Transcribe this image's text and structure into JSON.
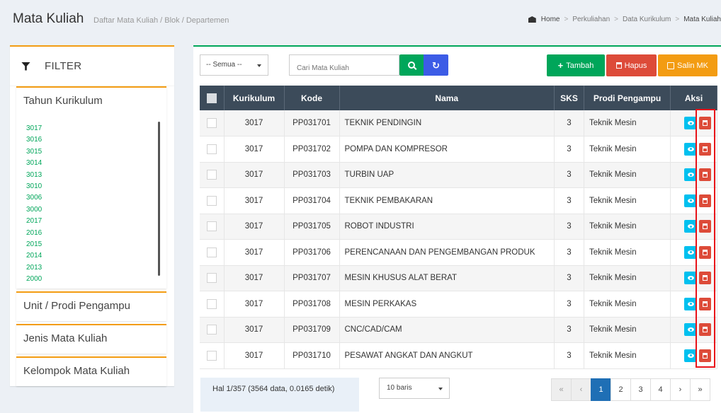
{
  "header": {
    "title": "Mata Kuliah",
    "subtitle": "Daftar Mata Kuliah / Blok / Departemen",
    "breadcrumb": [
      "Home",
      "Perkuliahan",
      "Data Kurikulum",
      "Mata Kuliah"
    ]
  },
  "filter": {
    "title": "FILTER",
    "tahun_label": "Tahun Kurikulum",
    "years": [
      "3017",
      "3016",
      "3015",
      "3014",
      "3013",
      "3010",
      "3006",
      "3000",
      "2017",
      "2016",
      "2015",
      "2014",
      "2013",
      "2000"
    ],
    "unit_label": "Unit / Prodi Pengampu",
    "jenis_label": "Jenis Mata Kuliah",
    "kelompok_label": "Kelompok Mata Kuliah"
  },
  "toolbar": {
    "select_value": "-- Semua --",
    "search_placeholder": "Cari Mata Kuliah",
    "tambah_label": "Tambah",
    "hapus_label": "Hapus",
    "salin_label": "Salin MK"
  },
  "table": {
    "columns": [
      "Kurikulum",
      "Kode",
      "Nama",
      "SKS",
      "Prodi Pengampu",
      "Aksi"
    ],
    "rows": [
      {
        "kurikulum": "3017",
        "kode": "PP031701",
        "nama": "TEKNIK PENDINGIN",
        "sks": "3",
        "prodi": "Teknik Mesin"
      },
      {
        "kurikulum": "3017",
        "kode": "PP031702",
        "nama": "POMPA DAN KOMPRESOR",
        "sks": "3",
        "prodi": "Teknik Mesin"
      },
      {
        "kurikulum": "3017",
        "kode": "PP031703",
        "nama": "TURBIN UAP",
        "sks": "3",
        "prodi": "Teknik Mesin"
      },
      {
        "kurikulum": "3017",
        "kode": "PP031704",
        "nama": "TEKNIK PEMBAKARAN",
        "sks": "3",
        "prodi": "Teknik Mesin"
      },
      {
        "kurikulum": "3017",
        "kode": "PP031705",
        "nama": "ROBOT INDUSTRI",
        "sks": "3",
        "prodi": "Teknik Mesin"
      },
      {
        "kurikulum": "3017",
        "kode": "PP031706",
        "nama": "PERENCANAAN DAN PENGEMBANGAN PRODUK",
        "sks": "3",
        "prodi": "Teknik Mesin"
      },
      {
        "kurikulum": "3017",
        "kode": "PP031707",
        "nama": "MESIN KHUSUS ALAT BERAT",
        "sks": "3",
        "prodi": "Teknik Mesin"
      },
      {
        "kurikulum": "3017",
        "kode": "PP031708",
        "nama": "MESIN PERKAKAS",
        "sks": "3",
        "prodi": "Teknik Mesin"
      },
      {
        "kurikulum": "3017",
        "kode": "PP031709",
        "nama": "CNC/CAD/CAM",
        "sks": "3",
        "prodi": "Teknik Mesin"
      },
      {
        "kurikulum": "3017",
        "kode": "PP031710",
        "nama": "PESAWAT ANGKAT DAN ANGKUT",
        "sks": "3",
        "prodi": "Teknik Mesin"
      }
    ]
  },
  "footer": {
    "page_info": "Hal 1/357 (3564 data, 0.0165 detik)",
    "rows_per_page": "10 baris",
    "pages": [
      "«",
      "‹",
      "1",
      "2",
      "3",
      "4",
      "›",
      "»"
    ],
    "active_page": "1"
  },
  "colors": {
    "green": "#00a65a",
    "red": "#dd4b39",
    "orange": "#f39c12",
    "blue": "#3c5ce6",
    "cyan": "#00c0ef",
    "table_header": "#3c4b5a",
    "highlight": "#e8141a"
  }
}
